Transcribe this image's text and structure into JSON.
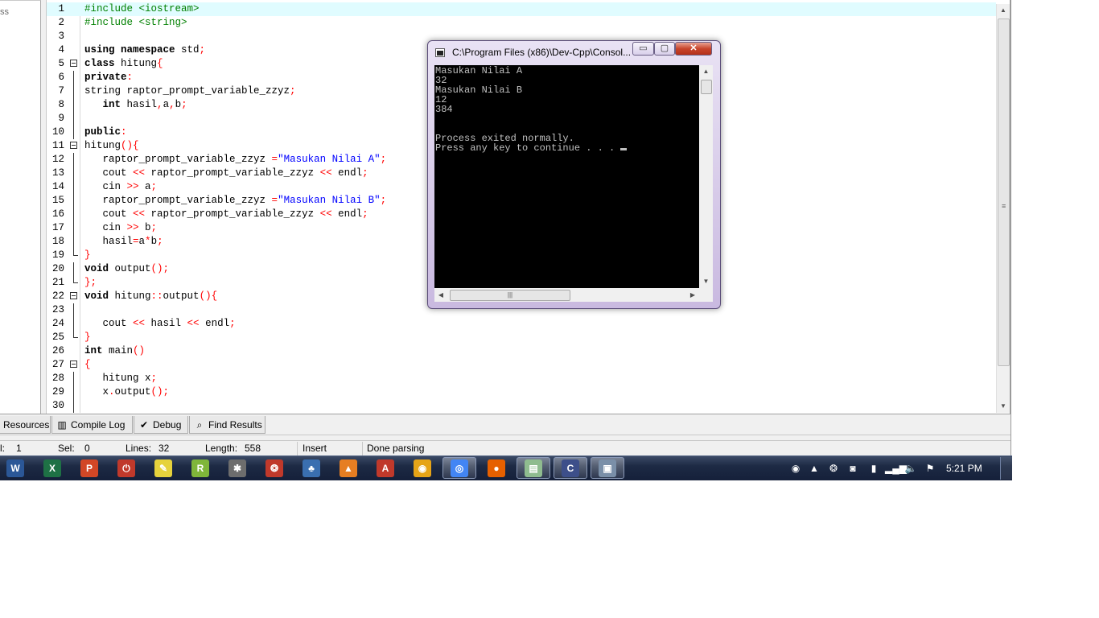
{
  "left_panel": {
    "stub_text": "ss"
  },
  "editor": {
    "lines": [
      {
        "n": "1",
        "fold": "none",
        "current": true,
        "tokens": [
          [
            "pp",
            "#include <iostream>"
          ]
        ]
      },
      {
        "n": "2",
        "fold": "none",
        "tokens": [
          [
            "pp",
            "#include <string>"
          ]
        ]
      },
      {
        "n": "3",
        "fold": "none",
        "tokens": []
      },
      {
        "n": "4",
        "fold": "none",
        "tokens": [
          [
            "kw",
            "using namespace "
          ],
          [
            "txt",
            "std"
          ],
          [
            "sym",
            ";"
          ]
        ]
      },
      {
        "n": "5",
        "fold": "open",
        "tokens": [
          [
            "kw",
            "class "
          ],
          [
            "txt",
            "hitung"
          ],
          [
            "sym",
            "{"
          ]
        ]
      },
      {
        "n": "6",
        "fold": "bar",
        "tokens": [
          [
            "kw",
            "private"
          ],
          [
            "sym",
            ":"
          ]
        ]
      },
      {
        "n": "7",
        "fold": "bar",
        "tokens": [
          [
            "txt",
            "string raptor_prompt_variable_zzyz"
          ],
          [
            "sym",
            ";"
          ]
        ]
      },
      {
        "n": "8",
        "fold": "bar",
        "tokens": [
          [
            "txt",
            "   "
          ],
          [
            "kw",
            "int "
          ],
          [
            "txt",
            "hasil"
          ],
          [
            "sym",
            ","
          ],
          [
            "txt",
            "a"
          ],
          [
            "sym",
            ","
          ],
          [
            "txt",
            "b"
          ],
          [
            "sym",
            ";"
          ]
        ]
      },
      {
        "n": "9",
        "fold": "bar",
        "tokens": []
      },
      {
        "n": "10",
        "fold": "bar",
        "tokens": [
          [
            "kw",
            "public"
          ],
          [
            "sym",
            ":"
          ]
        ]
      },
      {
        "n": "11",
        "fold": "open",
        "tokens": [
          [
            "txt",
            "hitung"
          ],
          [
            "sym",
            "(){"
          ]
        ]
      },
      {
        "n": "12",
        "fold": "bar",
        "tokens": [
          [
            "txt",
            "   raptor_prompt_variable_zzyz "
          ],
          [
            "sym",
            "="
          ],
          [
            "str",
            "\"Masukan Nilai A\""
          ],
          [
            "sym",
            ";"
          ]
        ]
      },
      {
        "n": "13",
        "fold": "bar",
        "tokens": [
          [
            "txt",
            "   cout "
          ],
          [
            "sym",
            "<<"
          ],
          [
            "txt",
            " raptor_prompt_variable_zzyz "
          ],
          [
            "sym",
            "<<"
          ],
          [
            "txt",
            " endl"
          ],
          [
            "sym",
            ";"
          ]
        ]
      },
      {
        "n": "14",
        "fold": "bar",
        "tokens": [
          [
            "txt",
            "   cin "
          ],
          [
            "sym",
            ">>"
          ],
          [
            "txt",
            " a"
          ],
          [
            "sym",
            ";"
          ]
        ]
      },
      {
        "n": "15",
        "fold": "bar",
        "tokens": [
          [
            "txt",
            "   raptor_prompt_variable_zzyz "
          ],
          [
            "sym",
            "="
          ],
          [
            "str",
            "\"Masukan Nilai B\""
          ],
          [
            "sym",
            ";"
          ]
        ]
      },
      {
        "n": "16",
        "fold": "bar",
        "tokens": [
          [
            "txt",
            "   cout "
          ],
          [
            "sym",
            "<<"
          ],
          [
            "txt",
            " raptor_prompt_variable_zzyz "
          ],
          [
            "sym",
            "<<"
          ],
          [
            "txt",
            " endl"
          ],
          [
            "sym",
            ";"
          ]
        ]
      },
      {
        "n": "17",
        "fold": "bar",
        "tokens": [
          [
            "txt",
            "   cin "
          ],
          [
            "sym",
            ">>"
          ],
          [
            "txt",
            " b"
          ],
          [
            "sym",
            ";"
          ]
        ]
      },
      {
        "n": "18",
        "fold": "bar",
        "tokens": [
          [
            "txt",
            "   hasil"
          ],
          [
            "sym",
            "="
          ],
          [
            "txt",
            "a"
          ],
          [
            "sym",
            "*"
          ],
          [
            "txt",
            "b"
          ],
          [
            "sym",
            ";"
          ]
        ]
      },
      {
        "n": "19",
        "fold": "end",
        "tokens": [
          [
            "sym",
            "}"
          ]
        ]
      },
      {
        "n": "20",
        "fold": "bar",
        "tokens": [
          [
            "kw",
            "void "
          ],
          [
            "txt",
            "output"
          ],
          [
            "sym",
            "();"
          ]
        ]
      },
      {
        "n": "21",
        "fold": "end",
        "tokens": [
          [
            "sym",
            "};"
          ]
        ]
      },
      {
        "n": "22",
        "fold": "open",
        "tokens": [
          [
            "kw",
            "void "
          ],
          [
            "txt",
            "hitung"
          ],
          [
            "sym",
            "::"
          ],
          [
            "txt",
            "output"
          ],
          [
            "sym",
            "(){"
          ]
        ]
      },
      {
        "n": "23",
        "fold": "bar",
        "tokens": []
      },
      {
        "n": "24",
        "fold": "bar",
        "tokens": [
          [
            "txt",
            "   cout "
          ],
          [
            "sym",
            "<<"
          ],
          [
            "txt",
            " hasil "
          ],
          [
            "sym",
            "<<"
          ],
          [
            "txt",
            " endl"
          ],
          [
            "sym",
            ";"
          ]
        ]
      },
      {
        "n": "25",
        "fold": "end",
        "tokens": [
          [
            "sym",
            "}"
          ]
        ]
      },
      {
        "n": "26",
        "fold": "none",
        "tokens": [
          [
            "kw",
            "int "
          ],
          [
            "txt",
            "main"
          ],
          [
            "sym",
            "()"
          ]
        ]
      },
      {
        "n": "27",
        "fold": "open",
        "tokens": [
          [
            "sym",
            "{"
          ]
        ]
      },
      {
        "n": "28",
        "fold": "bar",
        "tokens": [
          [
            "txt",
            "   hitung x"
          ],
          [
            "sym",
            ";"
          ]
        ]
      },
      {
        "n": "29",
        "fold": "bar",
        "tokens": [
          [
            "txt",
            "   x"
          ],
          [
            "sym",
            "."
          ],
          [
            "txt",
            "output"
          ],
          [
            "sym",
            "();"
          ]
        ]
      },
      {
        "n": "30",
        "fold": "bar",
        "tokens": []
      }
    ]
  },
  "panel_tabs": [
    {
      "label": "Resources",
      "icon": "resources-icon"
    },
    {
      "label": "Compile Log",
      "icon": "bar-chart-icon"
    },
    {
      "label": "Debug",
      "icon": "check-icon"
    },
    {
      "label": "Find Results",
      "icon": "find-icon"
    }
  ],
  "status": {
    "col_label": "l:",
    "col_value": "1",
    "sel_label": "Sel:",
    "sel_value": "0",
    "lines_label": "Lines:",
    "lines_value": "32",
    "length_label": "Length:",
    "length_value": "558",
    "mode": "Insert",
    "message": "Done parsing"
  },
  "console": {
    "title": "C:\\Program Files (x86)\\Dev-Cpp\\Consol...",
    "output": "Masukan Nilai A\n32\nMasukan Nilai B\n12\n384\n\n\nProcess exited normally.\nPress any key to continue . . . ",
    "minimize_glyph": "▭",
    "maximize_glyph": "▢",
    "close_glyph": "✕",
    "hscroll_grip": "|||"
  },
  "taskbar": {
    "clock": "5:21 PM",
    "apps": [
      {
        "name": "word-icon",
        "glyph": "W",
        "color": "#2b5797"
      },
      {
        "name": "excel-icon",
        "glyph": "X",
        "color": "#1e7145"
      },
      {
        "name": "powerpoint-icon",
        "glyph": "P",
        "color": "#d24726"
      },
      {
        "name": "power-icon",
        "glyph": "⏻",
        "color": "#c0392b"
      },
      {
        "name": "paint-icon",
        "glyph": "✎",
        "color": "#e6d23c"
      },
      {
        "name": "raptor-icon",
        "glyph": "R",
        "color": "#7fb63a"
      },
      {
        "name": "tool-icon",
        "glyph": "✱",
        "color": "#6d6d6d"
      },
      {
        "name": "swirl-icon",
        "glyph": "❂",
        "color": "#c0392b"
      },
      {
        "name": "network-icon",
        "glyph": "♣",
        "color": "#3a6fb0"
      },
      {
        "name": "vlc-icon",
        "glyph": "▲",
        "color": "#e67e22"
      },
      {
        "name": "pdf-icon",
        "glyph": "A",
        "color": "#c0392b"
      },
      {
        "name": "avast-icon",
        "glyph": "◉",
        "color": "#e6a417"
      },
      {
        "name": "chrome-icon",
        "glyph": "◎",
        "color": "#4285f4"
      },
      {
        "name": "firefox-icon",
        "glyph": "●",
        "color": "#e66000"
      },
      {
        "name": "folder-icon",
        "glyph": "▤",
        "color": "#8fbc8f"
      },
      {
        "name": "devcpp-icon",
        "glyph": "C",
        "color": "#3d4f8a"
      },
      {
        "name": "console-icon",
        "glyph": "▣",
        "color": "#7a8fa8"
      }
    ],
    "tray": [
      {
        "name": "avast-tray-icon",
        "glyph": "◉"
      },
      {
        "name": "triangle-tray-icon",
        "glyph": "▲"
      },
      {
        "name": "swirl-tray-icon",
        "glyph": "❂"
      },
      {
        "name": "drive-tray-icon",
        "glyph": "◙"
      },
      {
        "name": "battery-icon",
        "glyph": "▮"
      },
      {
        "name": "signal-icon",
        "glyph": "▂▄▆"
      },
      {
        "name": "volume-icon",
        "glyph": "🔈"
      },
      {
        "name": "flag-icon",
        "glyph": "⚑"
      }
    ]
  }
}
